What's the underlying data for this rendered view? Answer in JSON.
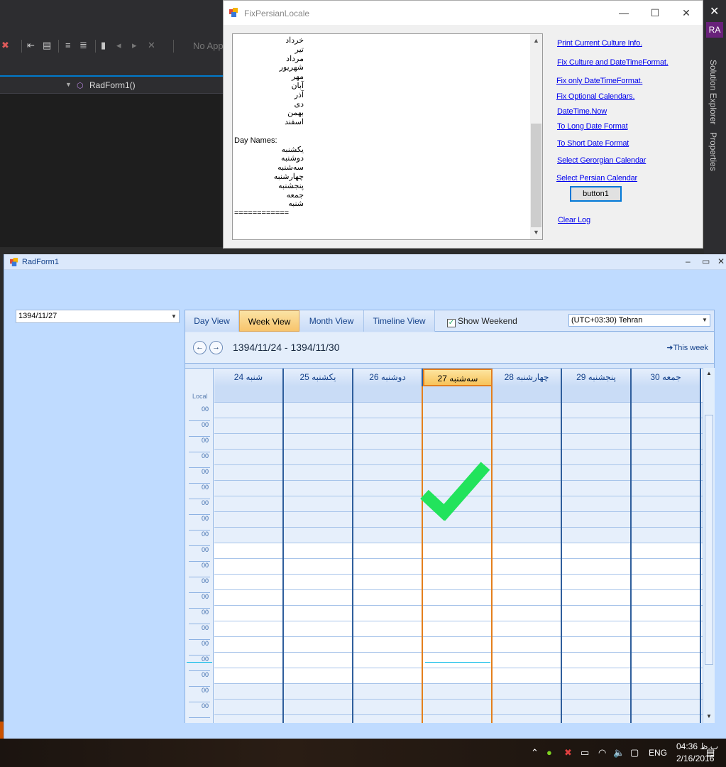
{
  "vs": {
    "no_app": "No App",
    "member_name": "RadForm1()",
    "user_initials": "RA",
    "side_tabs": [
      "Solution Explorer",
      "Properties"
    ]
  },
  "fix_window": {
    "title": "FixPersianLocale",
    "log_lines": [
      {
        "text": "خرداد",
        "indent": true
      },
      {
        "text": "تیر",
        "indent": true
      },
      {
        "text": "مرداد",
        "indent": true
      },
      {
        "text": "شهریور",
        "indent": true
      },
      {
        "text": "مهر",
        "indent": true
      },
      {
        "text": "آبان",
        "indent": true
      },
      {
        "text": "آذر",
        "indent": true
      },
      {
        "text": "دی",
        "indent": true
      },
      {
        "text": "بهمن",
        "indent": true
      },
      {
        "text": "اسفند",
        "indent": true
      },
      {
        "text": "",
        "indent": false
      },
      {
        "text": "Day Names:",
        "indent": false
      },
      {
        "text": "یکشنبه",
        "indent": true
      },
      {
        "text": "دوشنبه",
        "indent": true
      },
      {
        "text": "سه‌شنبه",
        "indent": true
      },
      {
        "text": "چهارشنبه",
        "indent": true
      },
      {
        "text": "پنجشنبه",
        "indent": true
      },
      {
        "text": "جمعه",
        "indent": true
      },
      {
        "text": "شنبه",
        "indent": true
      },
      {
        "text": "============",
        "indent": false
      }
    ],
    "links": {
      "print_culture": "Print Current Culture Info.",
      "fix_culture": "Fix Culture and DateTimeFormat.",
      "fix_datetime": "Fix only DateTimeFormat.",
      "fix_optional": "Fix Optional Calendars.",
      "datetime_now": "DateTime.Now",
      "to_long": "To Long Date Format",
      "to_short": "To Short Date Format",
      "select_gregorian": "Select Gerorgian Calendar",
      "select_persian": "Select Persian Calendar",
      "clear_log": "Clear Log"
    },
    "button1": "button1"
  },
  "rad_window": {
    "title": "RadForm1",
    "date_value": "1394/11/27",
    "tabs": [
      "Day View",
      "Week View",
      "Month View",
      "Timeline View"
    ],
    "active_tab": "Week View",
    "show_weekend_label": "Show Weekend",
    "show_weekend_checked": true,
    "timezone": "(UTC+03:30) Tehran",
    "range": "1394/11/24 - 1394/11/30",
    "this_week": "This week",
    "local_label": "Local",
    "days": [
      "شنبه 24",
      "یکشنبه 25",
      "دوشنبه 26",
      "سه‌شنبه 27",
      "چهارشنبه 28",
      "پنجشنبه 29",
      "جمعه 30"
    ],
    "today_index": 3,
    "time_labels": [
      "00",
      "00",
      "00",
      "00",
      "00",
      "00",
      "00",
      "00",
      "00",
      "00",
      "00",
      "00",
      "00",
      "00",
      "00",
      "00",
      "00",
      "00",
      "00",
      "00"
    ],
    "check_color": "#22e35c"
  },
  "taskbar": {
    "lang": "ENG",
    "time": "04:36 ب.ظ",
    "date": "2/16/2016"
  }
}
